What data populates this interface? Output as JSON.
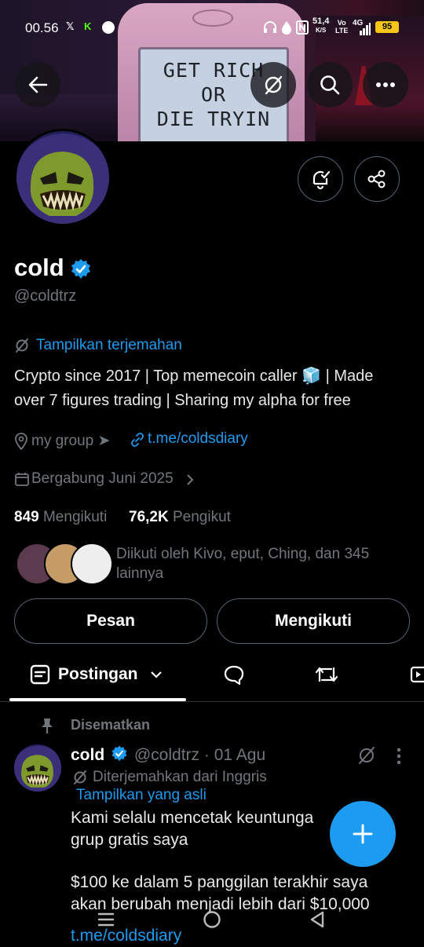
{
  "status_bar": {
    "time": "00.56",
    "icons": [
      "x-icon",
      "kick-icon",
      "app-icon"
    ],
    "net_speed_value": "51,4",
    "net_speed_unit": "K/S",
    "vo": "Vo",
    "lte": "LTE",
    "network": "4G",
    "battery": "95"
  },
  "banner": {
    "sign_lines": [
      "GET RICH",
      "OR",
      "DIE TRYIN"
    ]
  },
  "profile": {
    "name": "cold",
    "handle": "@coldtrz",
    "translate_label": "Tampilkan terjemahan",
    "bio": "Crypto since 2017 | Top memecoin caller 🧊 | Made over 7 figures trading | Sharing my alpha for free",
    "location": "my group ➤",
    "link": "t.me/coldsdiary",
    "joined": "Bergabung Juni 2025",
    "following_count": "849",
    "following_label": "Mengikuti",
    "followers_count": "76,2K",
    "followers_label": "Pengikut",
    "followed_by": "Diikuti oleh Kivo, eput, Ching, dan 345 lainnya"
  },
  "actions": {
    "message": "Pesan",
    "following": "Mengikuti"
  },
  "tabs": {
    "posts": "Postingan"
  },
  "post": {
    "pinned_label": "Disematkan",
    "author": "cold",
    "handle": "@coldtrz",
    "dot": "·",
    "date": "01 Agu",
    "translated_from": "Diterjemahkan dari Inggris",
    "show_original": "Tampilkan yang asli",
    "text_1": "Kami selalu mencetak keuntunga",
    "text_2": "grup gratis saya",
    "text_3": "$100 ke dalam 5 panggilan terakhir saya",
    "text_4": "akan berubah menjadi lebih dari $10,000",
    "text_5": "t.me/coldsdiary"
  },
  "colors": {
    "accent": "#1d9bf0",
    "background": "#000000",
    "text": "#e7e9ea",
    "muted": "#71767b"
  }
}
